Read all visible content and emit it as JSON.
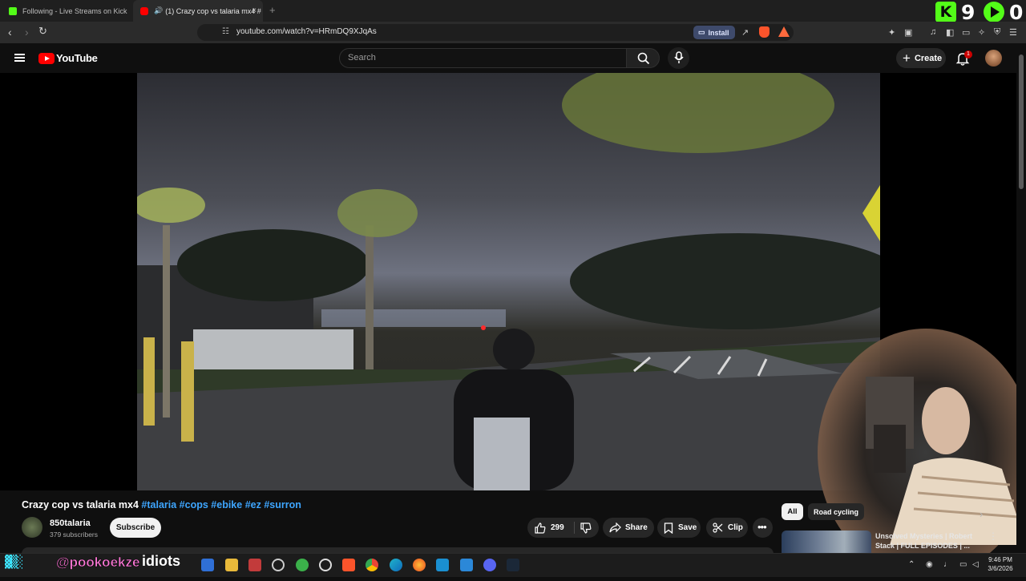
{
  "browser": {
    "tabs": [
      {
        "title": "Following - Live Streams on Kick",
        "favicon_color": "#53fc18",
        "active": false
      },
      {
        "title": "(1) Crazy cop vs talaria mx4 #",
        "favicon_color": "#ff0000",
        "active": true
      }
    ],
    "new_tab_label": "+",
    "close_label": "×",
    "url": "youtube.com/watch?v=HRmDQ9XJqAs",
    "install_label": "Install"
  },
  "overlay": {
    "kick_count": "9",
    "rumble_count": "0",
    "kick_letter": "K",
    "stream_name": "@pookoekze",
    "stream_word": "idiots"
  },
  "youtube": {
    "logo_text": "YouTube",
    "search_placeholder": "Search",
    "create_label": "Create",
    "notification_count": "1",
    "video": {
      "title": "Crazy cop vs talaria mx4",
      "hashtags": [
        "#talaria",
        "#cops",
        "#ebike",
        "#ez",
        "#surron"
      ],
      "channel_name": "850talaria",
      "subscribers": "379 subscribers",
      "subscribe_label": "Subscribe",
      "likes": "299",
      "share_label": "Share",
      "save_label": "Save",
      "clip_label": "Clip"
    },
    "chips": [
      "All",
      "Road cycling"
    ],
    "recommendation": {
      "title": "Unsolved Mysteries | Robert Stack | FULL EPISODES | ..."
    }
  },
  "taskbar": {
    "time": "9:46 PM",
    "date": "3/6/2026"
  }
}
